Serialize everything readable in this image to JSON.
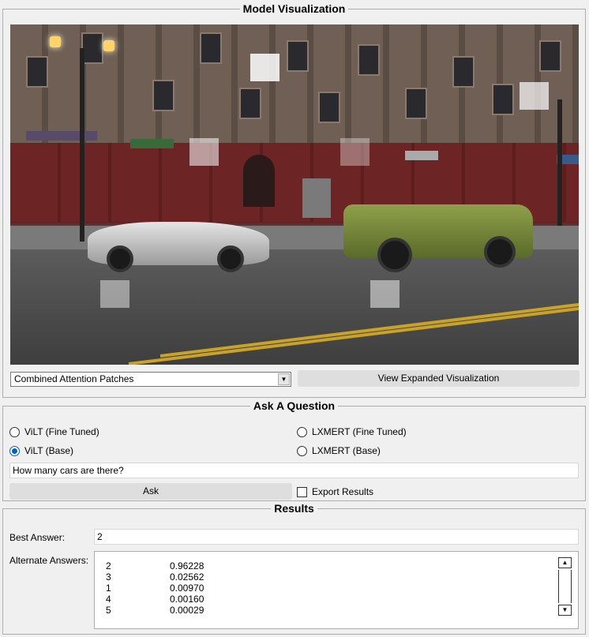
{
  "visualization": {
    "title": "Model Visualization",
    "dropdown_value": "Combined Attention Patches",
    "expand_button": "View Expanded Visualization",
    "image_description_icon": "street-scene-image"
  },
  "ask": {
    "title": "Ask A Question",
    "models": [
      {
        "label": "ViLT (Fine Tuned)",
        "checked": false
      },
      {
        "label": "LXMERT (Fine Tuned)",
        "checked": false
      },
      {
        "label": "ViLT (Base)",
        "checked": true
      },
      {
        "label": "LXMERT (Base)",
        "checked": false
      }
    ],
    "question": "How many cars are there?",
    "ask_button": "Ask",
    "export_label": "Export Results",
    "export_checked": false
  },
  "results": {
    "title": "Results",
    "best_label": "Best Answer:",
    "best_value": "2",
    "alt_label": "Alternate Answers:",
    "alternates": [
      {
        "answer": "2",
        "score": "0.96228"
      },
      {
        "answer": "3",
        "score": "0.02562"
      },
      {
        "answer": "1",
        "score": "0.00970"
      },
      {
        "answer": "4",
        "score": "0.00160"
      },
      {
        "answer": "5",
        "score": "0.00029"
      }
    ]
  },
  "colors": {
    "accent": "#0060c0",
    "button_bg": "#dedede",
    "window_bg": "#f0f0f0"
  }
}
